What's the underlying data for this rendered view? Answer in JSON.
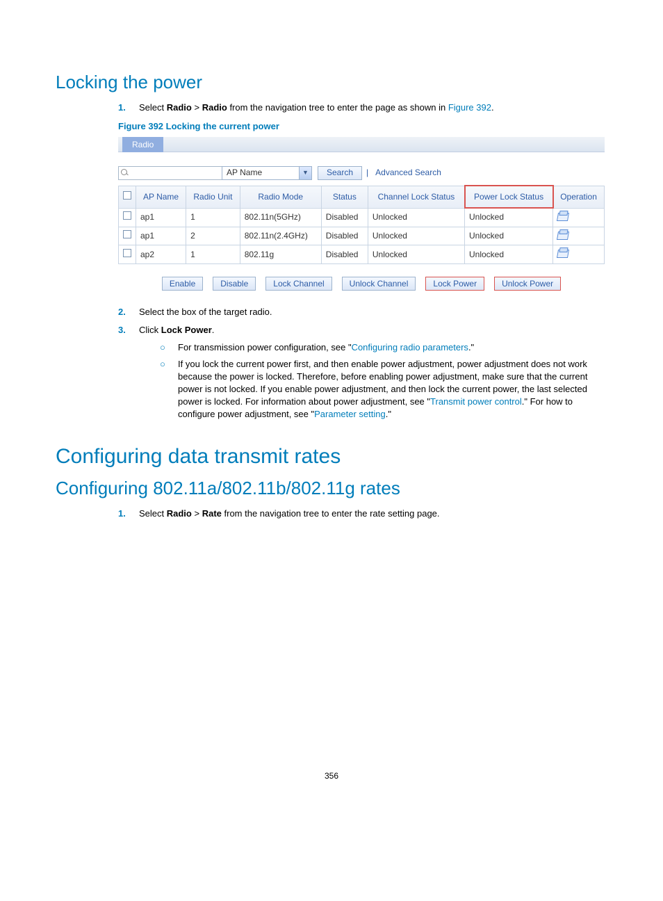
{
  "section1": {
    "title": "Locking the power",
    "steps": {
      "s1_prefix": "Select ",
      "s1_b1": "Radio",
      "s1_gt": " > ",
      "s1_b2": "Radio",
      "s1_mid": " from the navigation tree to enter the page as shown in ",
      "s1_link": "Figure 392",
      "s1_end": ".",
      "fig_caption": "Figure 392 Locking the current power",
      "s2": "Select the box of the target radio.",
      "s3_prefix": "Click ",
      "s3_b": "Lock Power",
      "s3_end": ".",
      "sub1_prefix": "For transmission power configuration, see \"",
      "sub1_link": "Configuring radio parameters",
      "sub1_end": ".\"",
      "sub2_a": "If you lock the current power first, and then enable power adjustment, power adjustment does not work because the power is locked. Therefore, before enabling power adjustment, make sure that the current power is not locked. If you enable power adjustment, and then lock the current power, the last selected power is locked. For information about power adjustment, see \"",
      "sub2_link1": "Transmit power control",
      "sub2_b": ".\" For how to configure power adjustment, see \"",
      "sub2_link2": "Parameter setting",
      "sub2_c": ".\""
    }
  },
  "section2": {
    "title": "Configuring data transmit rates",
    "subtitle": "Configuring 802.11a/802.11b/802.11g rates",
    "s1_prefix": "Select ",
    "s1_b1": "Radio",
    "s1_gt": " > ",
    "s1_b2": "Rate",
    "s1_end": " from the navigation tree to enter the rate setting page."
  },
  "figure": {
    "tab": "Radio",
    "dropdown": "AP Name",
    "search_btn": "Search",
    "adv_search": "Advanced Search",
    "headers": {
      "ap": "AP Name",
      "unit": "Radio Unit",
      "mode": "Radio Mode",
      "status": "Status",
      "chlock": "Channel Lock Status",
      "pwrlock": "Power Lock Status",
      "op": "Operation"
    },
    "rows": [
      {
        "ap": "ap1",
        "unit": "1",
        "mode": "802.11n(5GHz)",
        "status": "Disabled",
        "chlock": "Unlocked",
        "pwrlock": "Unlocked"
      },
      {
        "ap": "ap1",
        "unit": "2",
        "mode": "802.11n(2.4GHz)",
        "status": "Disabled",
        "chlock": "Unlocked",
        "pwrlock": "Unlocked"
      },
      {
        "ap": "ap2",
        "unit": "1",
        "mode": "802.11g",
        "status": "Disabled",
        "chlock": "Unlocked",
        "pwrlock": "Unlocked"
      }
    ],
    "buttons": {
      "enable": "Enable",
      "disable": "Disable",
      "lockch": "Lock Channel",
      "unlockch": "Unlock Channel",
      "lockpw": "Lock Power",
      "unlockpw": "Unlock Power"
    }
  },
  "page_number": "356"
}
